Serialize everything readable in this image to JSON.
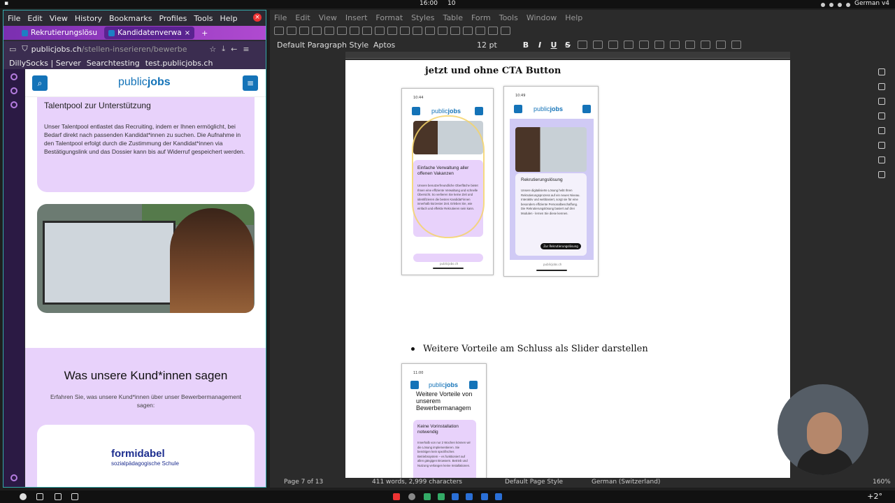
{
  "topbar": {
    "clock": "16:00",
    "notif": "10",
    "language": "German v4"
  },
  "firefox": {
    "menu": [
      "File",
      "Edit",
      "View",
      "History",
      "Bookmarks",
      "Profiles",
      "Tools",
      "Help"
    ],
    "tabs": [
      {
        "label": "Rekrutierungslösu",
        "active": false
      },
      {
        "label": "Kandidatenverwa",
        "active": true
      }
    ],
    "url": {
      "host": "publicjobs.ch",
      "path": "/stellen-inserieren/bewerbe"
    },
    "bookmarks": [
      "DillySocks | Server",
      "Searchtesting",
      "test.publicjobs.ch"
    ]
  },
  "page": {
    "logo_light": "public",
    "logo_bold": "jobs",
    "card_title": "Talentpool zur Unterstützung",
    "card_text": "Unser Talentpool entlastet das Recruiting, indem er Ihnen ermöglicht, bei Bedarf direkt nach passenden Kandidat*innen zu suchen. Die Aufnahme in den Talentpool erfolgt durch die Zustimmung der Kandidat*innen via Bestätigungslink und das Dossier kann bis auf Widerruf gespeichert werden.",
    "section_title": "Was unsere Kund*innen sagen",
    "section_sub": "Erfahren Sie, was unsere Kund*innen über unser Bewerbermanagement sagen:",
    "testimonial_brand": "formidabel",
    "testimonial_sub": "sozialpädagogische Schule"
  },
  "writer": {
    "menu": [
      "File",
      "Edit",
      "View",
      "Insert",
      "Format",
      "Styles",
      "Table",
      "Form",
      "Tools",
      "Window",
      "Help"
    ],
    "paragraph_style": "Default Paragraph Style",
    "font": "Aptos",
    "size": "12 pt",
    "doc": {
      "heading_line": "jetzt und ohne CTA Button",
      "phone1": {
        "time": "10:44",
        "title": "Einfache Verwaltung aller offenen Vakanzen",
        "text": "Unsere benutzerfreundliche Oberfläche bietet Ihnen eine effiziente Verwaltung und schnelle Übersicht. So verlieren Sie keine Zeit und identifizieren die besten Kandidat*innen innerhalb kürzester Zeit. Erleben Sie, wie einfach und effektiv Rekrutieren sein kann.",
        "footer": "publicjobs.ch"
      },
      "phone2": {
        "time": "10:49",
        "title": "Rekrutierungslösung",
        "text": "Unsere digitalisierte Lösung hebt Ihren Rekrutierungsprozess auf ein neues Niveau. Interaktiv und webbasiert, sorgt sie für eine besonders effiziente Personalbeschaffung. Die Rekrutierungslösung basiert auf drei Modulen - lernen Sie diese kennen.",
        "cta": "Zur Rekrutierungslösung",
        "footer": "publicjobs.ch"
      },
      "bullet": "Weitere Vorteile am Schluss als Slider darstellen",
      "phone3": {
        "time": "11:00",
        "heading": "Weitere Vorteile von unserem Bewerbermanagem",
        "title": "Keine Vorinstallation notwendig",
        "text": "Innerhalb von nur 2 Wochen können wir die Lösung implementieren. Sie benötigen kein spezifisches Betriebssystem – es funktioniert auf allen gängigen Browsern. Betrieb und Nutzung verlangen keine Installationen."
      }
    },
    "status": {
      "page": "Page 7 of 13",
      "words": "411 words, 2,999 characters",
      "page_style": "Default Page Style",
      "language": "German (Switzerland)",
      "zoom": "160%"
    }
  },
  "taskbar": {
    "temperature": "+2°"
  },
  "colors": {
    "brand_blue": "#1473b8",
    "lavender": "#e8d2fb",
    "firefox_purple": "#7a2fb0"
  }
}
